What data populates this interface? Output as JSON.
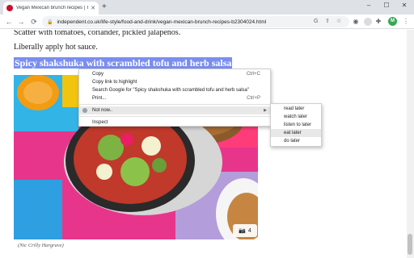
{
  "browser": {
    "tab": {
      "title": "Vegan Mexican brunch recipes | T",
      "close": "✕"
    },
    "new_tab": "+",
    "window_controls": {
      "minimize": "–",
      "maximize": "☐",
      "close": "✕"
    },
    "nav": {
      "back": "←",
      "forward": "→",
      "reload": "⟳"
    },
    "url": "independent.co.uk/life-style/food-and-drink/vegan-mexican-brunch-recipes-b2304024.html",
    "avatar_letter": "M"
  },
  "page": {
    "paragraph_1": "Scatter with tomatoes, coriander, pickled jalapenos.",
    "paragraph_2": "Liberally apply hot sauce.",
    "heading": "Spicy shakshuka with scrambled tofu and herb salsa",
    "caption": "(Nic Crilly Hargrave)",
    "gallery_count": "4"
  },
  "context_menu": {
    "items": [
      {
        "label": "Copy",
        "shortcut": "Ctrl+C"
      },
      {
        "label": "Copy link to highlight",
        "shortcut": ""
      },
      {
        "label": "Search Google for \"Spicy shakshuka with scrambled tofu and herb salsa\"",
        "shortcut": ""
      },
      {
        "label": "Print...",
        "shortcut": "Ctrl+P"
      },
      {
        "label": "Not now..",
        "shortcut": ""
      },
      {
        "label": "Inspect",
        "shortcut": ""
      }
    ],
    "submenu": [
      "read later",
      "watch later",
      "listen to later",
      "eat later",
      "do later"
    ]
  },
  "colors": {
    "selection": "#7a8ef0",
    "brand": "#c8102e"
  }
}
